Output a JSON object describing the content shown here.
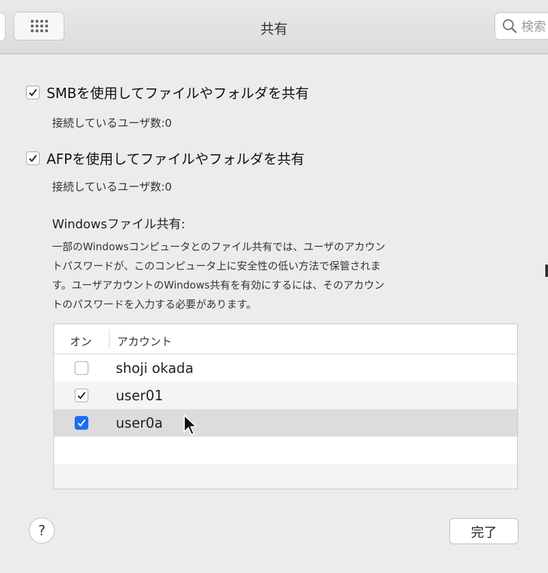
{
  "toolbar": {
    "title": "共有",
    "search_placeholder": "検索"
  },
  "smb": {
    "label": "SMBを使用してファイルやフォルダを共有",
    "checked": true,
    "connected_users": "接続しているユーザ数:0"
  },
  "afp": {
    "label": "AFPを使用してファイルやフォルダを共有",
    "checked": true,
    "connected_users": "接続しているユーザ数:0"
  },
  "windows": {
    "title": "Windowsファイル共有:",
    "description_lines": [
      "一部のWindowsコンピュータとのファイル共有では、ユーザのアカウン",
      "トパスワードが、このコンピュータ上に安全性の低い方法で保管されま",
      "す。ユーザアカウントのWindows共有を有効にするには、そのアカウン",
      "トのパスワードを入力する必要があります。"
    ]
  },
  "accounts_table": {
    "headers": {
      "on": "オン",
      "account": "アカウント"
    },
    "rows": [
      {
        "name": "shoji okada",
        "checked": false,
        "selected": false
      },
      {
        "name": "user01",
        "checked": true,
        "selected": false
      },
      {
        "name": "user0a",
        "checked": true,
        "selected": true
      }
    ]
  },
  "footer": {
    "help_label": "?",
    "done_label": "完了"
  },
  "colors": {
    "accent": "#1a6ff2",
    "selected_row": "#dcdcdc",
    "window_bg": "#ececec"
  }
}
